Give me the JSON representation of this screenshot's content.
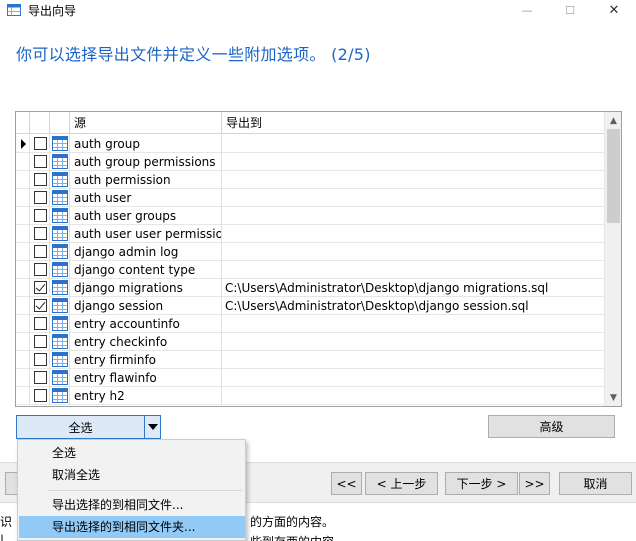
{
  "window": {
    "title": "导出向导",
    "minimize": "—",
    "maximize": "☐",
    "close": "✕"
  },
  "heading": "你可以选择导出文件并定义一些附加选项。 (2/5)",
  "grid": {
    "columns": {
      "source": "源",
      "target": "导出到"
    },
    "rows": [
      {
        "name": "auth group",
        "checked": false,
        "target": "",
        "current": true
      },
      {
        "name": "auth group permissions",
        "checked": false,
        "target": ""
      },
      {
        "name": "auth permission",
        "checked": false,
        "target": ""
      },
      {
        "name": "auth user",
        "checked": false,
        "target": ""
      },
      {
        "name": "auth user groups",
        "checked": false,
        "target": ""
      },
      {
        "name": "auth user user permissions",
        "checked": false,
        "target": ""
      },
      {
        "name": "django admin log",
        "checked": false,
        "target": ""
      },
      {
        "name": "django content type",
        "checked": false,
        "target": ""
      },
      {
        "name": "django migrations",
        "checked": true,
        "target": "C:\\Users\\Administrator\\Desktop\\django migrations.sql"
      },
      {
        "name": "django session",
        "checked": true,
        "target": "C:\\Users\\Administrator\\Desktop\\django session.sql"
      },
      {
        "name": "entry accountinfo",
        "checked": false,
        "target": ""
      },
      {
        "name": "entry checkinfo",
        "checked": false,
        "target": ""
      },
      {
        "name": "entry firminfo",
        "checked": false,
        "target": ""
      },
      {
        "name": "entry flawinfo",
        "checked": false,
        "target": ""
      },
      {
        "name": "entry h2",
        "checked": false,
        "target": ""
      }
    ]
  },
  "buttons": {
    "select_all": "全选",
    "advanced": "高级",
    "first": "<<",
    "prev": "< 上一步",
    "next": "下一步 >",
    "last": ">>",
    "cancel": "取消"
  },
  "menu": {
    "items": [
      {
        "label": "全选"
      },
      {
        "label": "取消全选"
      },
      {
        "label": "导出选择的到相同文件..."
      },
      {
        "label": "导出选择的到相同文件夹...",
        "highlighted": true
      }
    ]
  },
  "description": {
    "line1_head": "识",
    "line1_tail": "的方面的内容。",
    "line2_head": "| ",
    "line2_tail": "些到存西的内容"
  },
  "colors": {
    "heading": "#1a64c8",
    "menu_highlight": "#91c9f7",
    "split_button_bg": "#dde9f7"
  }
}
